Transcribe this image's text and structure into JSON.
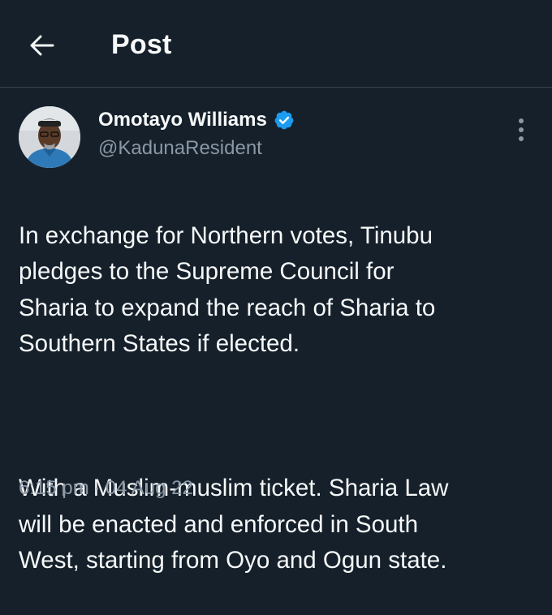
{
  "header": {
    "title": "Post",
    "back_icon": "arrow-left-icon"
  },
  "author": {
    "name": "Omotayo Williams",
    "handle": "@KadunaResident",
    "verified": true,
    "verified_color": "#1d9bf0"
  },
  "tweet": {
    "paragraphs": [
      "In exchange for Northern votes, Tinubu\npledges to the Supreme Council for\nSharia to expand the reach of Sharia to\nSouthern States if elected.",
      "With a Muslim-muslim ticket. Sharia Law\nwill be enacted and enforced in South\nWest, starting from Oyo and Ogun state."
    ],
    "time": "6:15 pm",
    "date": "04 Aug 22",
    "separator": "·"
  },
  "colors": {
    "background": "#15202b",
    "text": "#f7f9f9",
    "secondary": "#8b98a5",
    "border": "#38444d"
  }
}
